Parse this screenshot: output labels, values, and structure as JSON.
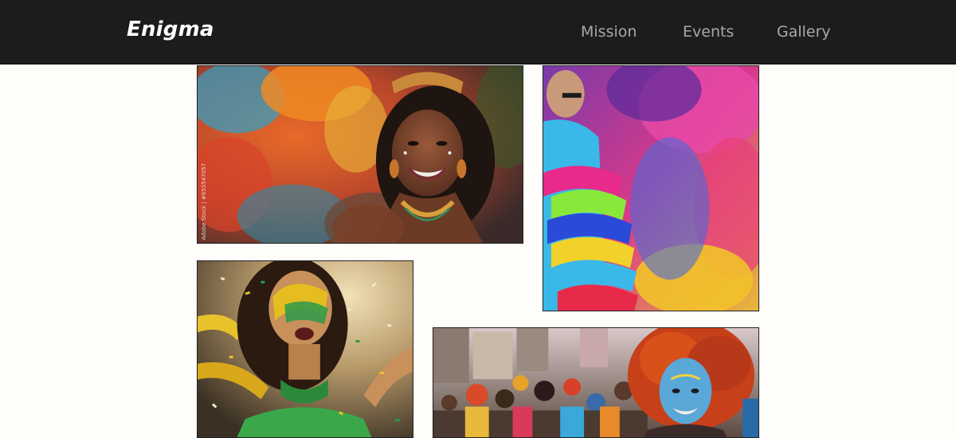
{
  "header": {
    "brand": "Enigma",
    "nav": [
      {
        "label": "Mission"
      },
      {
        "label": "Events"
      },
      {
        "label": "Gallery"
      }
    ]
  },
  "gallery": {
    "photos": [
      {
        "subject": "smiling carnival dancer with feathered headdress",
        "watermark": "Adobe Stock | #655547057"
      },
      {
        "subject": "dancer in colorful ruffled sleeves and flowing skirts"
      },
      {
        "subject": "dancer with yellow and green face paint amid confetti"
      },
      {
        "subject": "street parade with blue-painted face and red curly hair"
      }
    ]
  },
  "colors": {
    "nav_background": "#1c1c1c",
    "brand_text": "#ffffff",
    "nav_text": "#a8a8a8",
    "page_background": "#fffdfa"
  }
}
